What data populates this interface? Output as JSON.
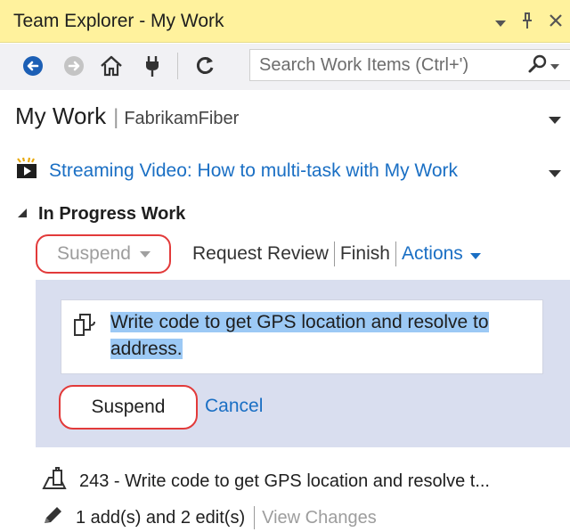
{
  "window": {
    "title": "Team Explorer - My Work"
  },
  "toolbar": {
    "search_placeholder": "Search Work Items (Ctrl+')"
  },
  "page": {
    "title": "My Work",
    "project": "FabrikamFiber"
  },
  "video": {
    "label": "Streaming Video: How to multi-task with My Work"
  },
  "in_progress": {
    "section_label": "In Progress Work",
    "suspend_label": "Suspend",
    "links": {
      "request_review": "Request Review",
      "finish": "Finish",
      "actions": "Actions"
    }
  },
  "suspend_panel": {
    "task_text": "Write code to get GPS location and resolve to address.",
    "suspend_button": "Suspend",
    "cancel_link": "Cancel"
  },
  "items": {
    "work_item": "243 - Write code to get GPS location and resolve t...",
    "changes": "1 add(s) and 2 edit(s)",
    "view_changes": "View Changes"
  },
  "colors": {
    "title_bar": "#fff29d",
    "link": "#1a6fc4",
    "panel": "#d9deef",
    "highlight": "#9cc9f5",
    "callout": "#e23a3a"
  }
}
